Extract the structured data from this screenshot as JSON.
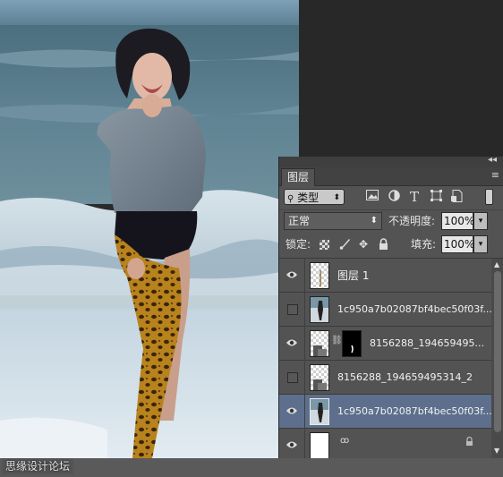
{
  "watermark": {
    "text": "思缘设计论坛"
  },
  "panel": {
    "collapse_icon": "◂◂",
    "menu_icon": "≡",
    "tab_label": "图层",
    "filter": {
      "kind_label": "类型",
      "icon_names": [
        "image-filter-icon",
        "adjustment-filter-icon",
        "type-filter-icon",
        "shape-filter-icon",
        "smart-object-filter-icon"
      ]
    },
    "blend_mode": "正常",
    "opacity_label": "不透明度:",
    "opacity_value": "100%",
    "lock_label": "锁定:",
    "fill_label": "填充:",
    "fill_value": "100%",
    "layers": [
      {
        "name": "图层 1",
        "visible": true,
        "selected": false
      },
      {
        "name": "1c950a7b02087bf4bec50f03f...",
        "visible": false,
        "selected": false
      },
      {
        "name": "8156288_194659495...",
        "visible": true,
        "selected": false,
        "has_mask": true
      },
      {
        "name": "8156288_194659495314_2",
        "visible": false,
        "selected": false
      },
      {
        "name": "1c950a7b02087bf4bec50f03f...",
        "visible": true,
        "selected": true
      },
      {
        "name": "",
        "visible": true,
        "selected": false
      }
    ]
  }
}
